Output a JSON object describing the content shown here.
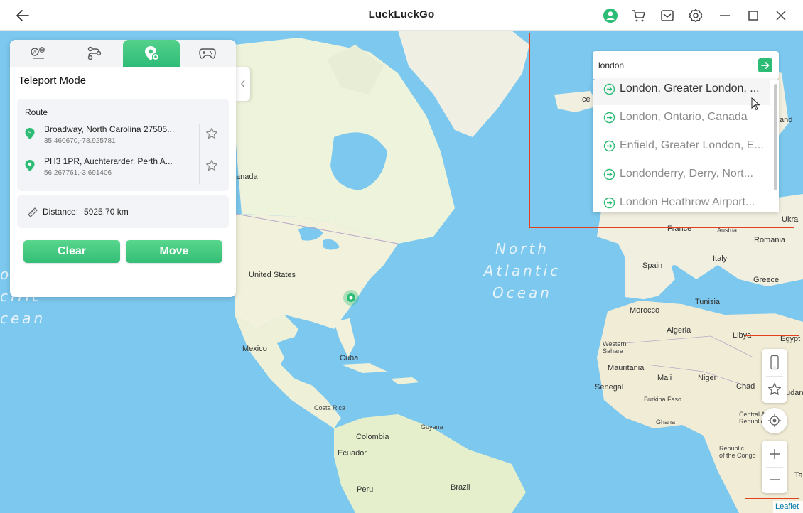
{
  "app": {
    "title": "LuckLuckGo"
  },
  "titlebar": {
    "icons": [
      "back-arrow-icon",
      "user-icon",
      "cart-icon",
      "mail-icon",
      "gear-icon",
      "minimize-icon",
      "maximize-icon",
      "close-icon"
    ],
    "accent_color": "#2dbc75"
  },
  "panel": {
    "tabs": [
      "teleport-ab-icon",
      "multi-route-icon",
      "teleport-pin-icon",
      "joystick-icon"
    ],
    "active_tab": 2,
    "mode_title": "Teleport Mode",
    "route_label": "Route",
    "route": [
      {
        "address": "Broadway, North Carolina 27505...",
        "coords": "35.460670,-78.925781",
        "marker": "S"
      },
      {
        "address": "PH3 1PR, Auchterarder, Perth A...",
        "coords": "56.267761,-3.691406",
        "marker": "pin"
      }
    ],
    "distance_label": "Distance:",
    "distance_value": "5925.70 km",
    "clear_label": "Clear",
    "move_label": "Move"
  },
  "search": {
    "value": "london",
    "results": [
      "London, Greater London, ...",
      "London, Ontario, Canada",
      "Enfield, Greater London, E...",
      "Londonderry, Derry, Nort...",
      "London Heathrow Airport..."
    ]
  },
  "map": {
    "ocean_label_north_atlantic": "North\nAtlantic\nOcean",
    "ocean_label_left": "o\ncific\ncean",
    "labels": {
      "iceland": "Ice",
      "land": "and",
      "canada": "anada",
      "united_states": "United States",
      "mexico": "Mexico",
      "cuba": "Cuba",
      "costa_rica": "Costa Rica",
      "colombia": "Colombia",
      "guyana": "Guyana",
      "ecuador": "Ecuador",
      "peru": "Peru",
      "brazil": "Brazil",
      "france": "France",
      "austria": "Austria",
      "ukraine": "Ukrai",
      "romania": "Romania",
      "spain": "Spain",
      "italy": "Italy",
      "greece": "Greece",
      "tunisia": "Tunisia",
      "morocco": "Morocco",
      "algeria": "Algeria",
      "libya": "Libya",
      "egypt": "Egypt",
      "western_sahara": "Western\nSahara",
      "mauritania": "Mauritania",
      "mali": "Mali",
      "niger": "Niger",
      "chad": "Chad",
      "sudan": "udan",
      "senegal": "Senegal",
      "burkina_faso": "Burkina Faso",
      "ghana": "Ghana",
      "car": "Central Afric\nRepublic",
      "congo": "Republic\nof the Congo",
      "tanzania": "Ta"
    },
    "attribution": "Leaflet"
  },
  "controls": [
    "phone-icon",
    "star-icon",
    "locate-icon",
    "zoom-in-icon",
    "zoom-out-icon"
  ]
}
